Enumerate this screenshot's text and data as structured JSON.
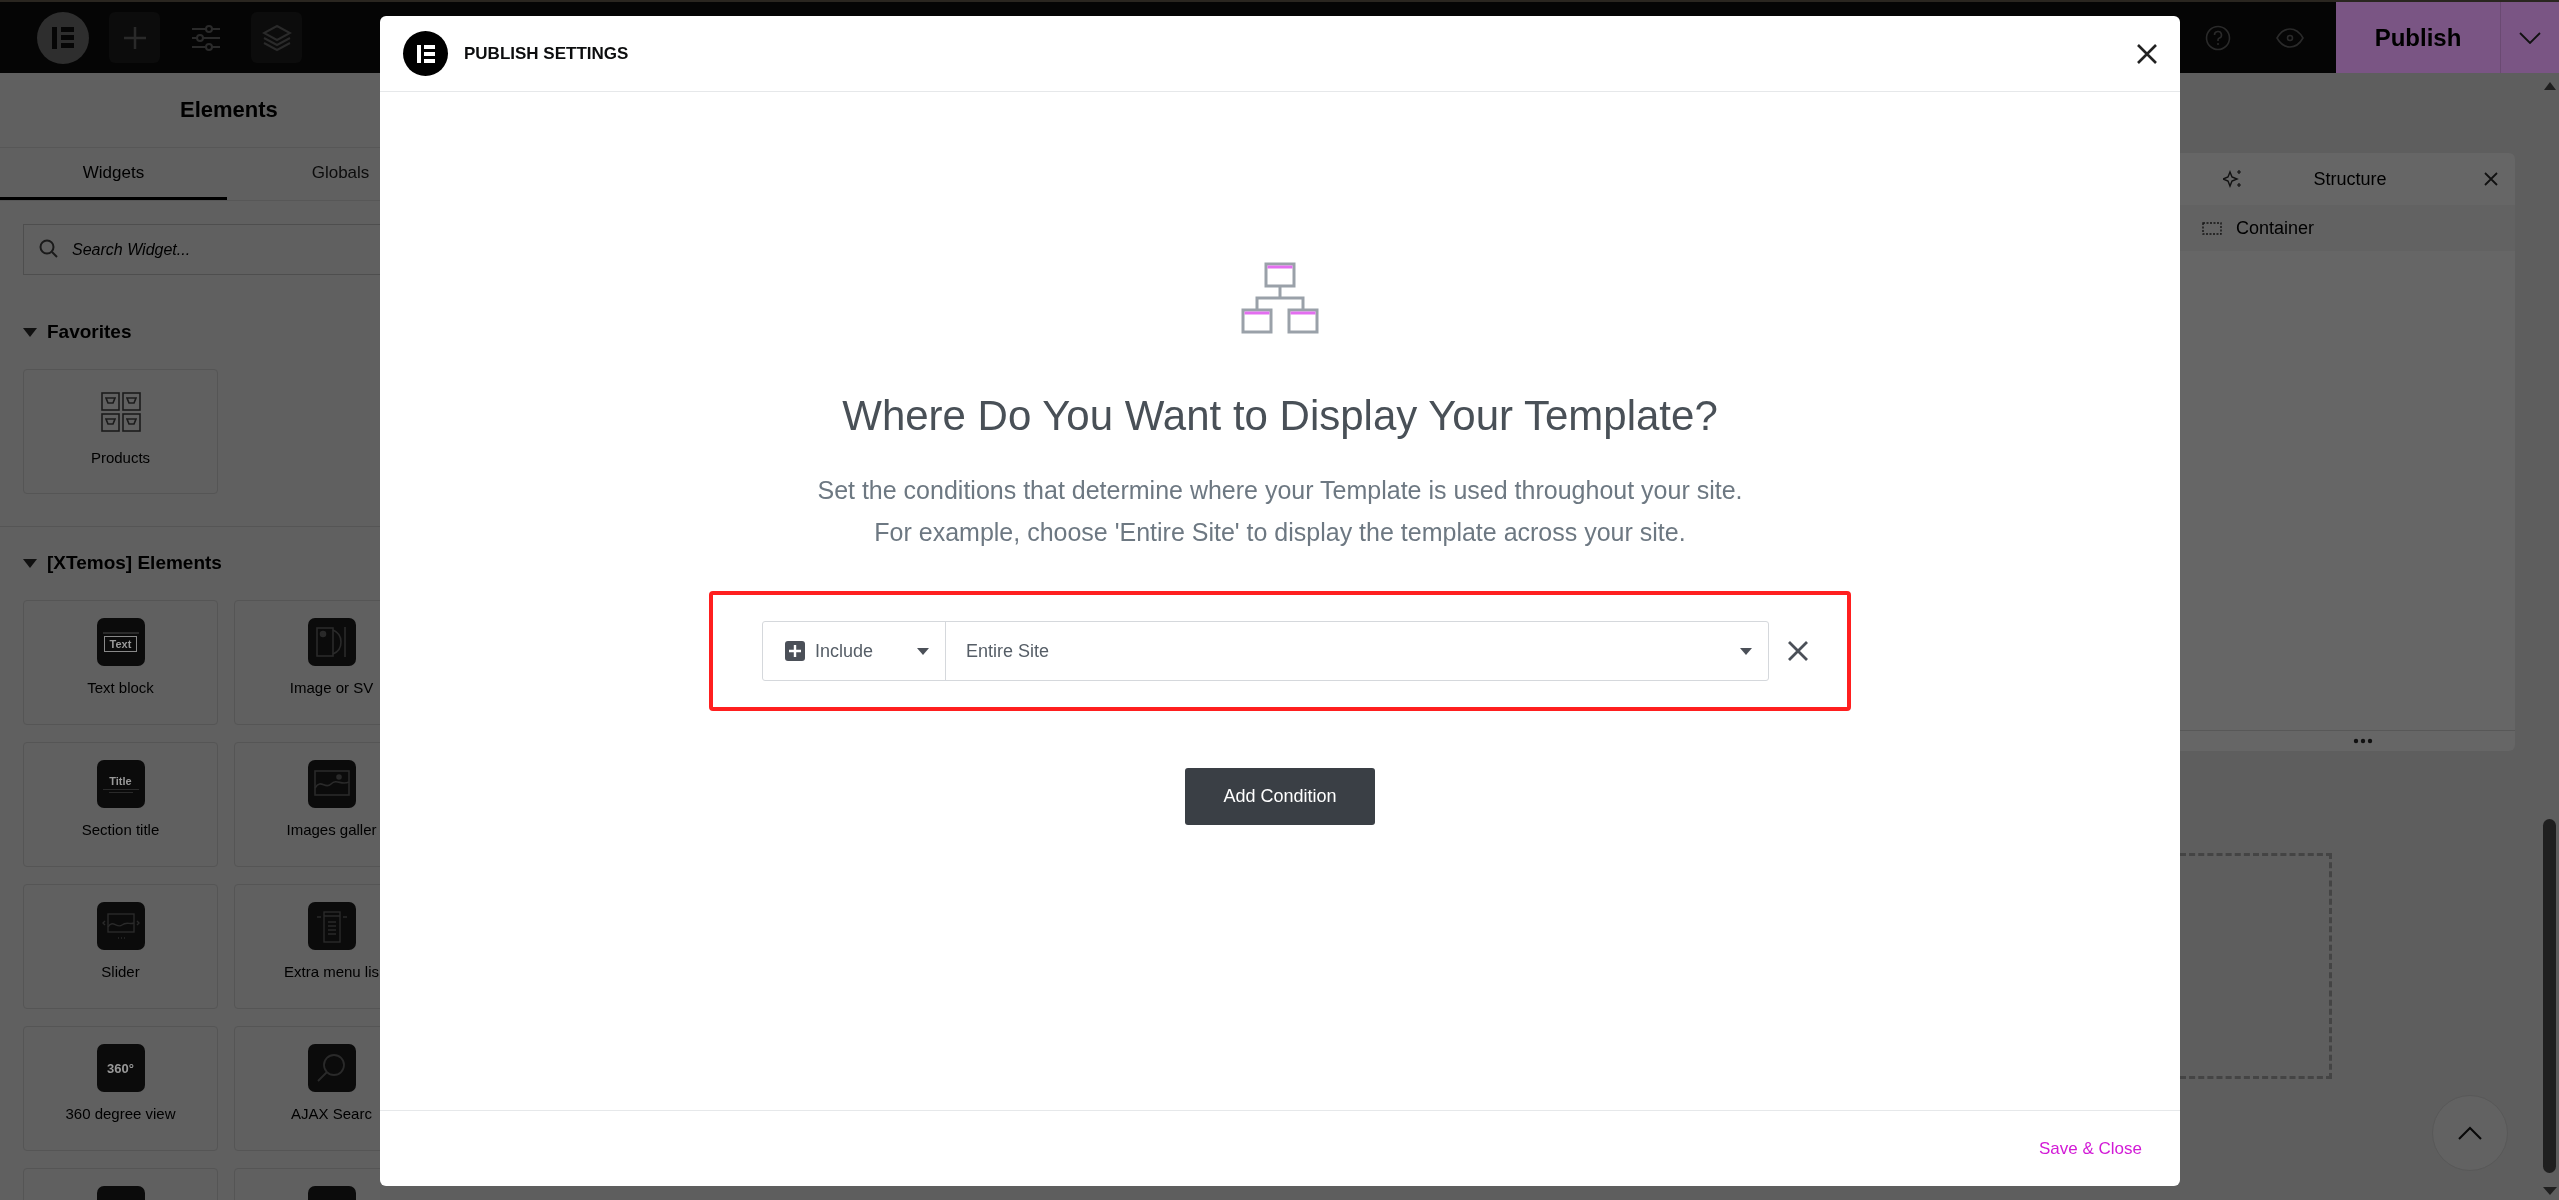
{
  "topbar": {
    "publish_button": "Publish"
  },
  "panel": {
    "title": "Elements",
    "tabs": [
      {
        "label": "Widgets",
        "selected": true
      },
      {
        "label": "Globals",
        "selected": false
      }
    ],
    "search": {
      "placeholder": "Search Widget..."
    },
    "sections": [
      {
        "title": "Favorites",
        "expanded": true,
        "widgets": [
          {
            "kind": "products",
            "label": "Products"
          }
        ]
      },
      {
        "title": "[XTemos] Elements",
        "expanded": true,
        "widgets": [
          {
            "kind": "text",
            "label": "Text block",
            "icon_text": "Text"
          },
          {
            "kind": "image",
            "label": "Image or SV"
          },
          {
            "kind": "title",
            "label": "Section title",
            "icon_text": "Title"
          },
          {
            "kind": "gallery",
            "label": "Images galler"
          },
          {
            "kind": "slider",
            "label": "Slider"
          },
          {
            "kind": "menu",
            "label": "Extra menu lis"
          },
          {
            "kind": "view360",
            "label": "360 degree view",
            "icon_text": "360°"
          },
          {
            "kind": "search",
            "label": "AJAX Searc"
          },
          {
            "kind": "list"
          },
          {
            "kind": "plain"
          }
        ]
      }
    ]
  },
  "structure": {
    "title": "Structure",
    "items": [
      {
        "label": "Container"
      }
    ]
  },
  "modal": {
    "title": "PUBLISH SETTINGS",
    "heading": "Where Do You Want to Display Your Template?",
    "description": [
      "Set the conditions that determine where your Template is used throughout your site.",
      "For example, choose 'Entire Site' to display the template across your site."
    ],
    "conditions": [
      {
        "type": "Include",
        "value": "Entire Site",
        "highlighted": true
      }
    ],
    "add_button": "Add Condition",
    "save_button": "Save & Close"
  }
}
